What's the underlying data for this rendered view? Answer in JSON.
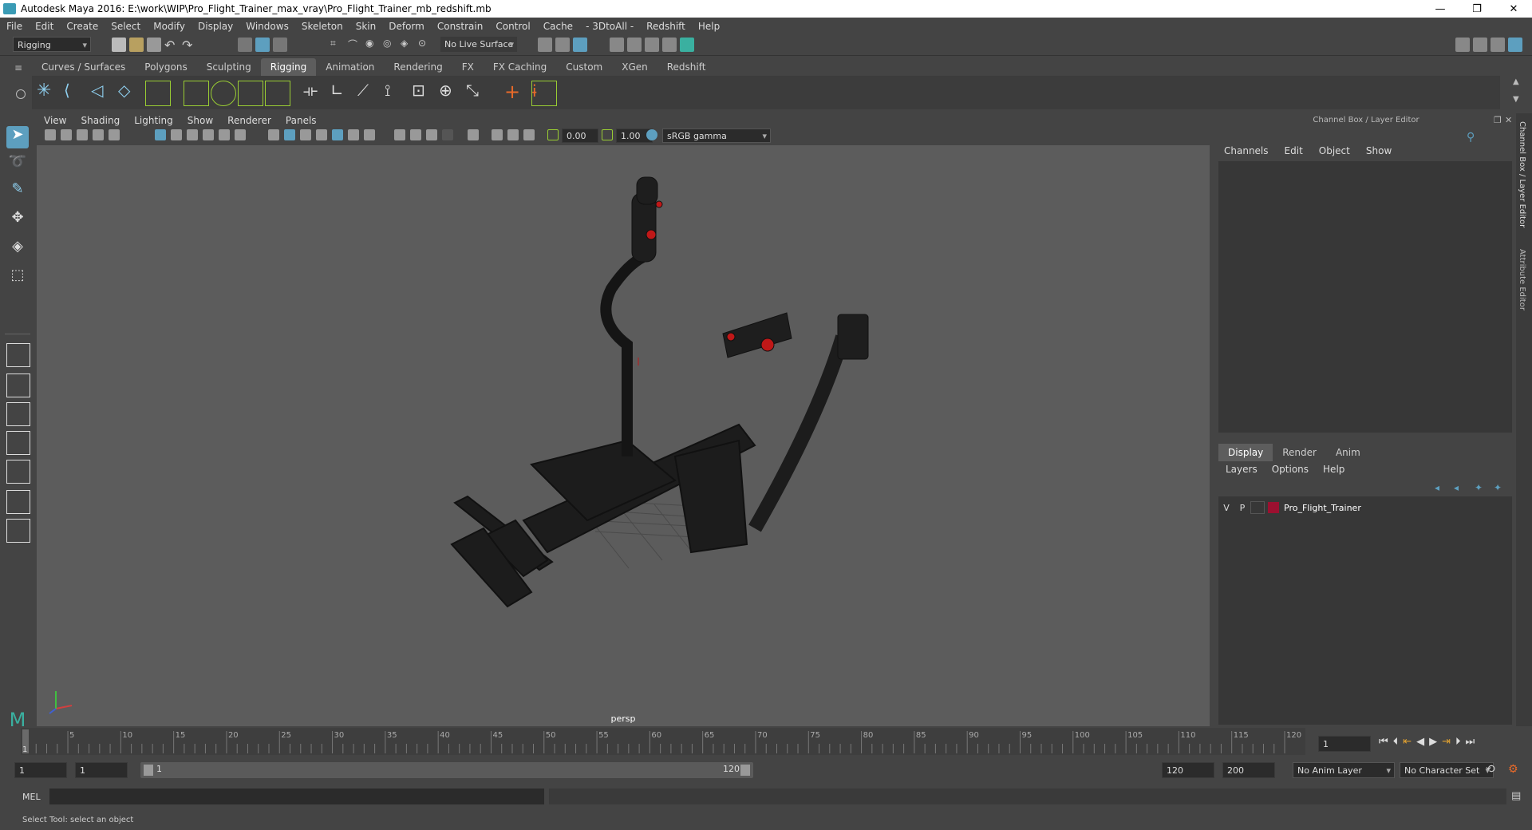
{
  "window": {
    "title": "Autodesk Maya 2016: E:\\work\\WIP\\Pro_Flight_Trainer_max_vray\\Pro_Flight_Trainer_mb_redshift.mb"
  },
  "menubar": [
    "File",
    "Edit",
    "Create",
    "Select",
    "Modify",
    "Display",
    "Windows",
    "Skeleton",
    "Skin",
    "Deform",
    "Constrain",
    "Control",
    "Cache",
    "- 3DtoAll -",
    "Redshift",
    "Help"
  ],
  "statusline": {
    "menu_set": "Rigging",
    "live_surface": "No Live Surface"
  },
  "shelf": {
    "tabs": [
      "Curves / Surfaces",
      "Polygons",
      "Sculpting",
      "Rigging",
      "Animation",
      "Rendering",
      "FX",
      "FX Caching",
      "Custom",
      "XGen",
      "Redshift"
    ],
    "active": "Rigging"
  },
  "viewport": {
    "menu": [
      "View",
      "Shading",
      "Lighting",
      "Show",
      "Renderer",
      "Panels"
    ],
    "exposure": "0.00",
    "gamma": "1.00",
    "color_space": "sRGB gamma",
    "camera": "persp"
  },
  "channel_box": {
    "header": "Channel Box / Layer Editor",
    "menu": [
      "Channels",
      "Edit",
      "Object",
      "Show"
    ],
    "layer_tabs": [
      "Display",
      "Render",
      "Anim"
    ],
    "active_layer_tab": "Display",
    "layer_menu": [
      "Layers",
      "Options",
      "Help"
    ],
    "layers": [
      {
        "v": "V",
        "p": "P",
        "name": "Pro_Flight_Trainer",
        "color": "#9b1030"
      }
    ]
  },
  "side_tabs": [
    "Channel Box / Layer Editor",
    "Attribute Editor"
  ],
  "timeline": {
    "ticks": [
      5,
      10,
      15,
      20,
      25,
      30,
      35,
      40,
      45,
      50,
      55,
      60,
      65,
      70,
      75,
      80,
      85,
      90,
      95,
      100,
      105,
      110,
      115,
      120
    ],
    "start_label": "1",
    "current_frame": "1",
    "min": 1,
    "max": 120
  },
  "range": {
    "start": "1",
    "playback_start": "1",
    "slider_start": "1",
    "slider_end": "120",
    "playback_end": "120",
    "end": "200",
    "anim_layer": "No Anim Layer",
    "character_set": "No Character Set"
  },
  "command_line": {
    "label": "MEL"
  },
  "help_line": {
    "text": "Select Tool: select an object"
  },
  "colors": {
    "accent": "#5d9fbf",
    "layer": "#9b1030",
    "model": "#1c1c1c"
  }
}
